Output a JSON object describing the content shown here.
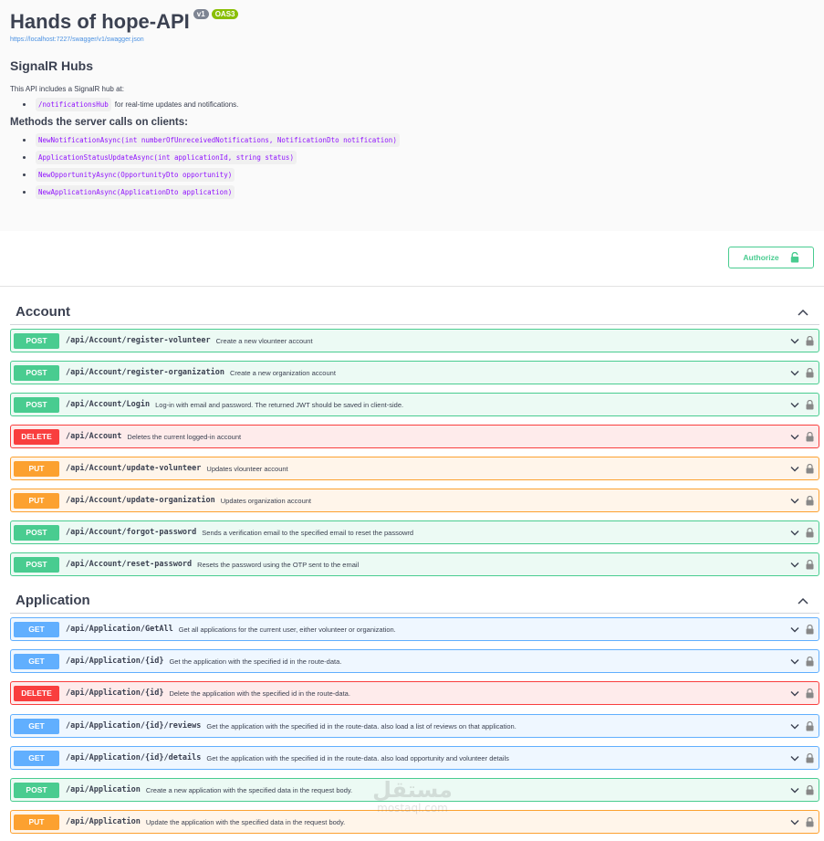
{
  "info": {
    "title": "Hands of hope-API",
    "version_badge": "v1",
    "oas_badge": "OAS3",
    "spec_url": "https://localhost:7227/swagger/v1/swagger.json",
    "hub_title": "SignalR Hubs",
    "intro": "This API includes a SignalR hub at:",
    "hub_path": "/notificationsHub",
    "hub_desc": "for real-time updates and notifications.",
    "methods_title": "Methods the server calls on clients:",
    "methods": [
      "NewNotificationAsync(int numberOfUnreceivedNotifications, NotificationDto notification)",
      "ApplicationStatusUpdateAsync(int applicationId, string status)",
      "NewOpportunityAsync(OpportunityDto opportunity)",
      "NewApplicationAsync(ApplicationDto application)"
    ]
  },
  "authorize": {
    "label": "Authorize"
  },
  "colors": {
    "post": "#49cc90",
    "delete": "#f93e3e",
    "put": "#fca130",
    "get": "#61afe"
  },
  "tags": [
    {
      "name": "Account",
      "operations": [
        {
          "method": "POST",
          "path": "/api/Account/register-volunteer",
          "summary": "Create a new vlounteer account"
        },
        {
          "method": "POST",
          "path": "/api/Account/register-organization",
          "summary": "Create a new organization account"
        },
        {
          "method": "POST",
          "path": "/api/Account/Login",
          "summary": "Log-in with email and password. The returned JWT should be saved in client-side."
        },
        {
          "method": "DELETE",
          "path": "/api/Account",
          "summary": "Deletes the current logged-in account"
        },
        {
          "method": "PUT",
          "path": "/api/Account/update-volunteer",
          "summary": "Updates vlounteer account"
        },
        {
          "method": "PUT",
          "path": "/api/Account/update-organization",
          "summary": "Updates organization account"
        },
        {
          "method": "POST",
          "path": "/api/Account/forgot-password",
          "summary": "Sends a verification email to the specified email to reset the passowrd"
        },
        {
          "method": "POST",
          "path": "/api/Account/reset-password",
          "summary": "Resets the password using the OTP sent to the email"
        }
      ]
    },
    {
      "name": "Application",
      "operations": [
        {
          "method": "GET",
          "path": "/api/Application/GetAll",
          "summary": "Get all applications for the current user, either volunteer or organization."
        },
        {
          "method": "GET",
          "path": "/api/Application/{id}",
          "summary": "Get the application with the specified id in the route-data."
        },
        {
          "method": "DELETE",
          "path": "/api/Application/{id}",
          "summary": "Delete the application with the specified id in the route-data."
        },
        {
          "method": "GET",
          "path": "/api/Application/{id}/reviews",
          "summary": "Get the application with the specified id in the route-data. also load a list of reviews on that application."
        },
        {
          "method": "GET",
          "path": "/api/Application/{id}/details",
          "summary": "Get the application with the specified id in the route-data. also load opportunity and volunteer details"
        },
        {
          "method": "POST",
          "path": "/api/Application",
          "summary": "Create a new application with the specified data in the request body."
        },
        {
          "method": "PUT",
          "path": "/api/Application",
          "summary": "Update the application with the specified data in the request body."
        }
      ]
    }
  ],
  "watermark": {
    "arabic": "مستقل",
    "latin": "mostaql.com"
  }
}
